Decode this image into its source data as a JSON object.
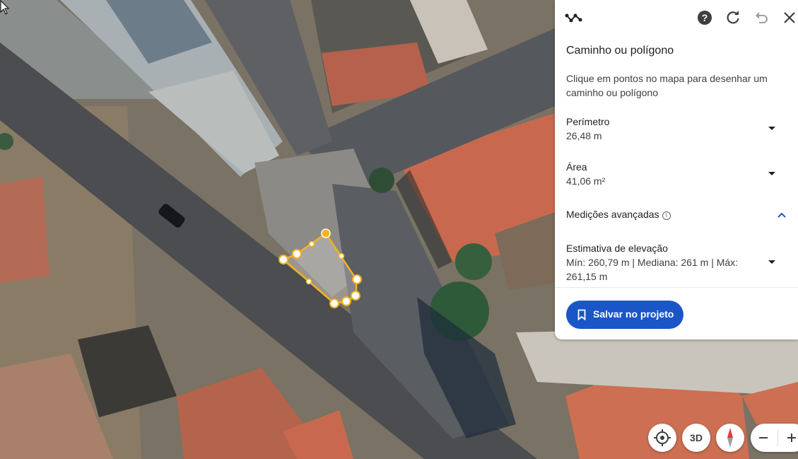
{
  "panel": {
    "title": "Caminho ou polígono",
    "description": "Clique em pontos no mapa para desenhar um caminho ou polígono",
    "perimeter": {
      "label": "Perímetro",
      "value": "26,48 m"
    },
    "area": {
      "label": "Área",
      "value": "41,06 m²"
    },
    "advanced": {
      "label": "Medições avançadas",
      "info_icon": "info-icon",
      "expanded": true
    },
    "elevation": {
      "label": "Estimativa de elevação",
      "value": "Mín: 260,79 m | Mediana: 261 m | Máx: 261,15 m"
    },
    "save_button": "Salvar no projeto",
    "header_icons": [
      "path-polygon-tool-icon",
      "help-icon",
      "refresh-icon",
      "undo-icon",
      "close-icon"
    ]
  },
  "map_controls": {
    "view_3d_label": "3D",
    "locate_icon": "locate-icon",
    "compass_icon": "compass-icon",
    "zoom_out_icon": "minus-icon",
    "zoom_in_icon": "plus-icon"
  },
  "colors": {
    "polygon_stroke": "#f5b21b",
    "accent": "#1a56c8"
  }
}
